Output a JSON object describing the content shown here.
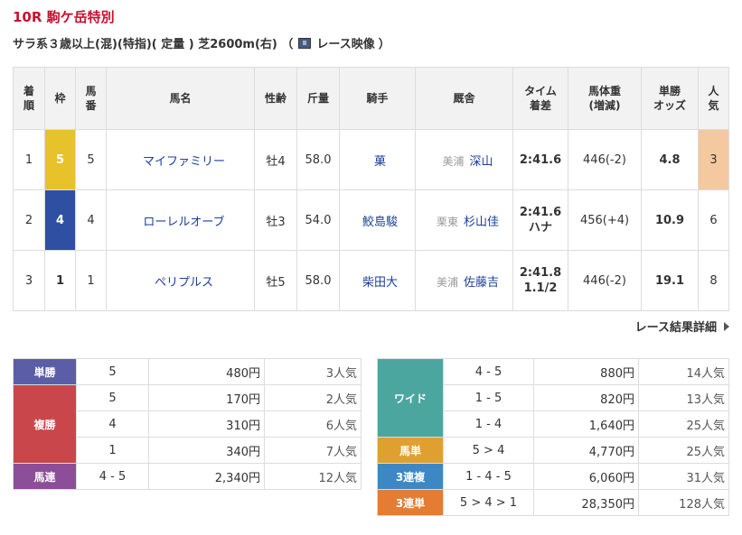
{
  "race": {
    "title": "10R 駒ケ岳特別",
    "condition_prefix": "サラ系３歳以上(混)(特指)( 定量 ) 芝2600m(右) （",
    "video_label": "レース映像",
    "condition_suffix": "）"
  },
  "results": {
    "headers": {
      "rank": "着\n順",
      "frame": "枠",
      "number": "馬\n番",
      "horse": "馬名",
      "sex_age": "性齢",
      "weight": "斤量",
      "jockey": "騎手",
      "stable": "厩舎",
      "time": "タイム\n着差",
      "body": "馬体重\n(増減)",
      "odds": "単勝\nオッズ",
      "pop": "人\n気"
    },
    "rows": [
      {
        "rank": "1",
        "frame": "5",
        "number": "5",
        "horse": "マイファミリー",
        "sex_age": "牡4",
        "weight": "58.0",
        "jockey": "菓",
        "region": "美浦",
        "trainer": "深山",
        "time": "2:41.6",
        "margin": "",
        "body": "446(-2)",
        "odds": "4.8",
        "pop": "3"
      },
      {
        "rank": "2",
        "frame": "4",
        "number": "4",
        "horse": "ローレルオーブ",
        "sex_age": "牡3",
        "weight": "54.0",
        "jockey": "鮫島駿",
        "region": "栗東",
        "trainer": "杉山佳",
        "time": "2:41.6",
        "margin": "ハナ",
        "body": "456(+4)",
        "odds": "10.9",
        "pop": "6"
      },
      {
        "rank": "3",
        "frame": "1",
        "number": "1",
        "horse": "ペリプルス",
        "sex_age": "牡5",
        "weight": "58.0",
        "jockey": "柴田大",
        "region": "美浦",
        "trainer": "佐藤吉",
        "time": "2:41.8",
        "margin": "1.1/2",
        "body": "446(-2)",
        "odds": "19.1",
        "pop": "8"
      }
    ]
  },
  "detail_link": "レース結果詳細",
  "payouts_left": {
    "win": {
      "label": "単勝",
      "rows": [
        {
          "combo": "5",
          "amount": "480円",
          "pop": "3人気"
        }
      ]
    },
    "place": {
      "label": "複勝",
      "rows": [
        {
          "combo": "5",
          "amount": "170円",
          "pop": "2人気"
        },
        {
          "combo": "4",
          "amount": "310円",
          "pop": "6人気"
        },
        {
          "combo": "1",
          "amount": "340円",
          "pop": "7人気"
        }
      ]
    },
    "quinella": {
      "label": "馬連",
      "rows": [
        {
          "combo": "4 - 5",
          "amount": "2,340円",
          "pop": "12人気"
        }
      ]
    }
  },
  "payouts_right": {
    "wide": {
      "label": "ワイド",
      "rows": [
        {
          "combo": "4 - 5",
          "amount": "880円",
          "pop": "14人気"
        },
        {
          "combo": "1 - 5",
          "amount": "820円",
          "pop": "13人気"
        },
        {
          "combo": "1 - 4",
          "amount": "1,640円",
          "pop": "25人気"
        }
      ]
    },
    "exacta": {
      "label": "馬単",
      "rows": [
        {
          "combo": "5 > 4",
          "amount": "4,770円",
          "pop": "25人気"
        }
      ]
    },
    "trio": {
      "label": "3連複",
      "rows": [
        {
          "combo": "1 - 4 - 5",
          "amount": "6,060円",
          "pop": "31人気"
        }
      ]
    },
    "trifecta": {
      "label": "3連単",
      "rows": [
        {
          "combo": "5 > 4 > 1",
          "amount": "28,350円",
          "pop": "128人気"
        }
      ]
    }
  },
  "colors": {
    "title_red": "#c8102e",
    "frame_5": "#e8c22b",
    "frame_4": "#2f4fa3",
    "frame_1": "#ffffff",
    "popularity_highlight": "#f4c9a0"
  }
}
